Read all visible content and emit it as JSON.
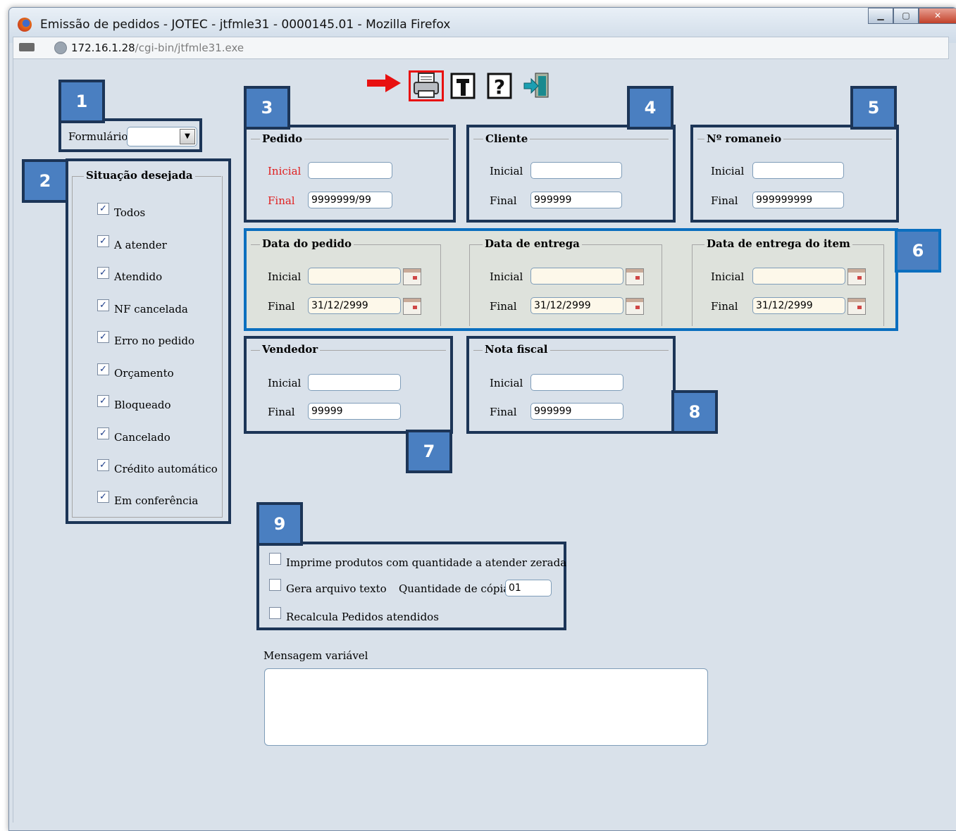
{
  "window": {
    "title": "Emissão de pedidos - JOTEC - jtfmle31 - 0000145.01 - Mozilla Firefox",
    "buttons": [
      "minimize",
      "maximize",
      "close"
    ]
  },
  "address": {
    "host": "172.16.1.28",
    "path": "/cgi-bin/jtfmle31.exe"
  },
  "toolbar": {
    "icons": [
      "printer-icon",
      "text-export-icon",
      "help-icon",
      "exit-icon"
    ],
    "highlighted": "printer-icon",
    "arrow_color": "#e81010"
  },
  "callouts": [
    "1",
    "2",
    "3",
    "4",
    "5",
    "6",
    "7",
    "8",
    "9"
  ],
  "formulario": {
    "label": "Formulário",
    "value": ""
  },
  "situacao": {
    "legend": "Situação desejada",
    "items": [
      {
        "label": "Todos",
        "checked": true
      },
      {
        "label": "A atender",
        "checked": true
      },
      {
        "label": "Atendido",
        "checked": true
      },
      {
        "label": "NF cancelada",
        "checked": true
      },
      {
        "label": "Erro no pedido",
        "checked": true
      },
      {
        "label": "Orçamento",
        "checked": true
      },
      {
        "label": "Bloqueado",
        "checked": true
      },
      {
        "label": "Cancelado",
        "checked": true
      },
      {
        "label": "Crédito automático",
        "checked": true
      },
      {
        "label": "Em conferência",
        "checked": true
      }
    ]
  },
  "pedido": {
    "legend": "Pedido",
    "inicial_label": "Inicial",
    "final_label": "Final",
    "inicial": "",
    "final": "9999999/99",
    "label_color": "#e02020"
  },
  "cliente": {
    "legend": "Cliente",
    "inicial_label": "Inicial",
    "final_label": "Final",
    "inicial": "",
    "final": "999999"
  },
  "romaneio": {
    "legend": "Nº romaneio",
    "inicial_label": "Inicial",
    "final_label": "Final",
    "inicial": "",
    "final": "999999999"
  },
  "data_pedido": {
    "legend": "Data do pedido",
    "inicial_label": "Inicial",
    "final_label": "Final",
    "inicial": "",
    "final": "31/12/2999"
  },
  "data_entrega": {
    "legend": "Data de entrega",
    "inicial_label": "Inicial",
    "final_label": "Final",
    "inicial": "",
    "final": "31/12/2999"
  },
  "data_entrega_item": {
    "legend": "Data de entrega do item",
    "inicial_label": "Inicial",
    "final_label": "Final",
    "inicial": "",
    "final": "31/12/2999"
  },
  "vendedor": {
    "legend": "Vendedor",
    "inicial_label": "Inicial",
    "final_label": "Final",
    "inicial": "",
    "final": "99999"
  },
  "nota_fiscal": {
    "legend": "Nota fiscal",
    "inicial_label": "Inicial",
    "final_label": "Final",
    "inicial": "",
    "final": "999999"
  },
  "opcoes": {
    "imprime_label": "Imprime produtos com quantidade a atender zerada",
    "imprime_checked": false,
    "gera_label": "Gera arquivo texto",
    "gera_checked": false,
    "copias_label": "Quantidade de cópias",
    "copias": "01",
    "recalcula_label": "Recalcula Pedidos atendidos",
    "recalcula_checked": false
  },
  "mensagem": {
    "label": "Mensagem variável",
    "value": ""
  }
}
